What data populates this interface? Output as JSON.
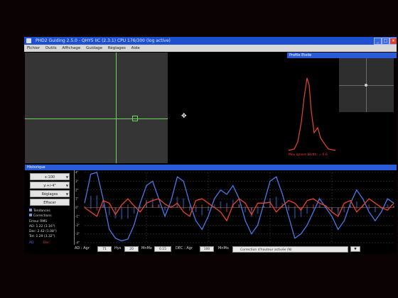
{
  "window": {
    "title": "PHD2 Guiding 2.5.0 - QHY5 IIC (2.3.1) CPU 176/300 (log active)",
    "controls": [
      "_",
      "□",
      "×"
    ]
  },
  "menu": [
    "Fichier",
    "Outils",
    "Affichage",
    "Guidage",
    "Réglages",
    "Aide"
  ],
  "profile": {
    "title": "Profile Etoile",
    "hfd": "Mov Ignore Width: = 6.6"
  },
  "history": {
    "title": "Historique",
    "controls": {
      "x_scale": "x:100",
      "y_scale": "y:+/-4\"",
      "settings": "Réglages",
      "clear": "Effacer"
    },
    "checkboxes": [
      "Tendances",
      "Corrections"
    ],
    "rms_label": "Erreur RMS",
    "rms": {
      "ra": "AD: 1.22 (3.16\")",
      "dec": "Dec: 2.42 (1.08\")",
      "tot": "Tot: 1.29 (3.32\")"
    },
    "series_labels": {
      "ra": "AD",
      "dec": "Dec"
    },
    "y_ticks": [
      "4\"",
      "3\"",
      "2\"",
      "1\"",
      "0\"",
      "-1\"",
      "-2\"",
      "-3\"",
      "-4\""
    ]
  },
  "bottombar": {
    "ra_label": "AD : Agr",
    "ra_agr": "71",
    "hys_label": "Hys",
    "hys": "20",
    "minmo_label": "MnMo",
    "minmo": "0.15",
    "dec_label": "DEC : Agr",
    "dec_agr": "100",
    "dec_mode_label": "MnMo",
    "dec_mode": "Correction d'hauteur activée (N)"
  },
  "colors": {
    "titlebar": "#1d4fd0",
    "ra_line": "#4a78e8",
    "dec_line": "#e8452a",
    "crosshair": "#6cd65c"
  },
  "chart_data": {
    "type": "line",
    "title": "",
    "xlabel": "",
    "ylabel": "",
    "ylim": [
      -4,
      4
    ],
    "x": [
      0,
      1,
      2,
      3,
      4,
      5,
      6,
      7,
      8,
      9,
      10,
      11,
      12,
      13,
      14,
      15,
      16,
      17,
      18,
      19,
      20,
      21,
      22,
      23,
      24,
      25,
      26,
      27,
      28,
      29,
      30,
      31,
      32,
      33,
      34,
      35,
      36,
      37,
      38,
      39,
      40,
      41,
      42,
      43,
      44,
      45,
      46,
      47,
      48,
      49,
      50
    ],
    "series": [
      {
        "name": "AD",
        "color": "#4a78e8",
        "values": [
          0.5,
          3.8,
          4,
          1,
          -2.5,
          -3.5,
          -3.8,
          -3.6,
          -2,
          0.5,
          2.5,
          3,
          1,
          -1,
          0.8,
          3.5,
          3,
          0.5,
          -1.5,
          -2.5,
          -1,
          1,
          2,
          1.5,
          2.5,
          1,
          -1.5,
          -3,
          -2,
          0.5,
          3,
          3.5,
          1.5,
          -1,
          -3.5,
          -3,
          -2,
          -0.5,
          1,
          0,
          -1,
          -2.5,
          -1.5,
          0.5,
          2,
          1,
          -0.5,
          -1.5,
          -0.5,
          1,
          0.5
        ]
      },
      {
        "name": "Dec",
        "color": "#e8452a",
        "values": [
          0,
          -0.5,
          -1,
          0.8,
          0.5,
          -0.8,
          0.3,
          1,
          0.2,
          -0.5,
          0.5,
          0.8,
          1,
          0.4,
          0,
          0.5,
          -0.5,
          -1,
          0.8,
          1,
          0.5,
          0,
          -0.5,
          -1.5,
          0.3,
          1,
          0.5,
          -0.8,
          0.5,
          0.5,
          0.6,
          -0.5,
          0.2,
          0.8,
          0.5,
          -0.3,
          0.8,
          1,
          0.5,
          0.2,
          -0.5,
          -1,
          0.5,
          0.8,
          -0.5,
          0.2,
          1,
          0.5,
          0,
          -0.3,
          0.5
        ]
      }
    ]
  }
}
